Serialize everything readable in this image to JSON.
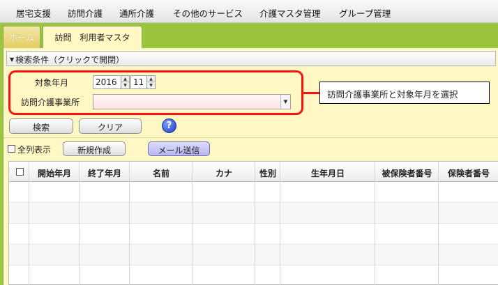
{
  "menu": [
    "居宅支援",
    "訪問介護",
    "通所介護",
    "その他のサービス",
    "介護マスタ管理",
    "グループ管理"
  ],
  "tabs": {
    "home": "ホーム",
    "active": "訪問　利用者マスタ"
  },
  "search": {
    "header": "検索条件（クリックで開閉）",
    "year_month_label": "対象年月",
    "year": "2016",
    "month": "11",
    "office_label": "訪問介護事業所",
    "office_value": "",
    "search_button": "検索",
    "clear_button": "クリア",
    "help_icon": "?"
  },
  "callout": "訪問介護事業所と対象年月を選択",
  "toolbar": {
    "show_all_label": "全列表示",
    "new_button": "新規作成",
    "mail_button": "メール送信"
  },
  "grid": {
    "columns": [
      "開始年月",
      "終了年月",
      "名前",
      "カナ",
      "性別",
      "生年月日",
      "被保険者番号",
      "保険者番号"
    ]
  },
  "colors": {
    "accent_green": "#9bc53d",
    "panel": "#fff8c4",
    "highlight": "#ff1010"
  }
}
